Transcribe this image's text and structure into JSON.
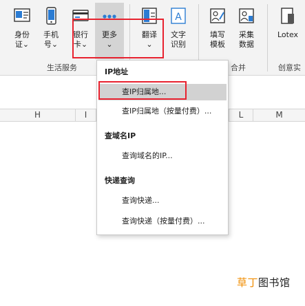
{
  "ribbon": {
    "buttons": [
      {
        "name": "id-card-button",
        "lines": [
          "身份",
          "证⌄"
        ]
      },
      {
        "name": "phone-button",
        "lines": [
          "手机",
          "号⌄"
        ]
      },
      {
        "name": "bank-card-button",
        "lines": [
          "银行",
          "卡⌄"
        ]
      },
      {
        "name": "more-button",
        "lines": [
          "更多",
          "⌄"
        ]
      },
      {
        "name": "translate-button",
        "lines": [
          "翻译",
          "⌄"
        ]
      },
      {
        "name": "ocr-button",
        "lines": [
          "文字",
          "识别"
        ]
      },
      {
        "name": "fill-template-button",
        "lines": [
          "填写",
          "模板"
        ]
      },
      {
        "name": "collect-data-button",
        "lines": [
          "采集",
          "数据"
        ]
      },
      {
        "name": "lotex-button",
        "lines": [
          "Lotex",
          ""
        ]
      }
    ],
    "groups": {
      "life_service": "生活服务",
      "merge_partial": "合并",
      "creative_partial": "创意实"
    }
  },
  "columns": [
    "H",
    "I",
    "L",
    "M"
  ],
  "menu": {
    "sections": [
      {
        "header": "IP地址",
        "items": [
          "查IP归属地...",
          "查IP归属地（按量付费）..."
        ]
      },
      {
        "header": "查域名IP",
        "items": [
          "查询域名的IP..."
        ]
      },
      {
        "header": "快递查询",
        "items": [
          "查询快递...",
          "查询快递（按量付费）..."
        ]
      }
    ],
    "active_item": "查IP归属地..."
  },
  "watermark": {
    "orange": "草丁",
    "dark": "图书馆"
  },
  "colors": {
    "highlight": "#e8212e",
    "accent": "#f08c00"
  }
}
